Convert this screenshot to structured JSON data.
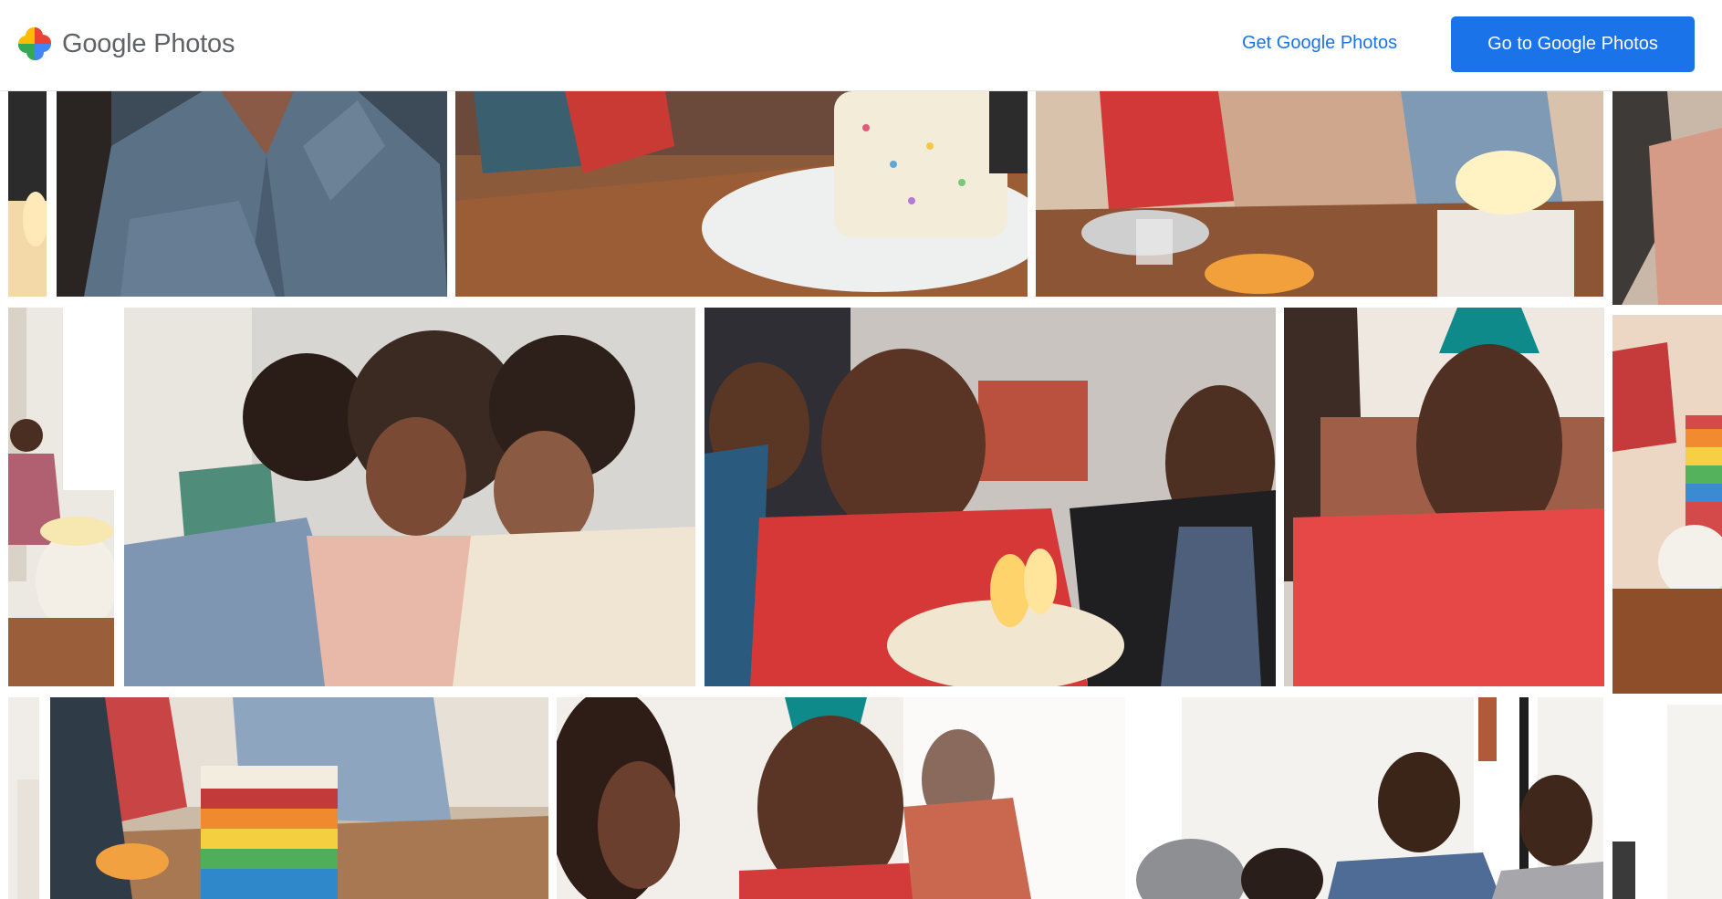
{
  "header": {
    "brand_word": "Google",
    "product_word": "Photos",
    "get_link_label": "Get Google Photos",
    "go_button_label": "Go to Google Photos"
  },
  "colors": {
    "accent": "#1a73e8",
    "logo_red": "#ea4335",
    "logo_yellow": "#fbbc04",
    "logo_green": "#34a853",
    "logo_blue": "#4285f4"
  },
  "photos": [
    {
      "row": 1,
      "subject": "edge-strip"
    },
    {
      "row": 1,
      "subject": "person-denim-shirt"
    },
    {
      "row": 1,
      "subject": "sprinkle-cake-on-table"
    },
    {
      "row": 1,
      "subject": "table-with-candles-cake"
    },
    {
      "row": 1,
      "subject": "edge-strip-right"
    },
    {
      "row": 2,
      "subject": "girl-in-kitchen"
    },
    {
      "row": 2,
      "subject": "laughing-girls"
    },
    {
      "row": 2,
      "subject": "boy-blowing-candles"
    },
    {
      "row": 2,
      "subject": "smiling-boy-party-hat"
    },
    {
      "row": 2,
      "subject": "rainbow-cake-edge"
    },
    {
      "row": 3,
      "subject": "edge-strip"
    },
    {
      "row": 3,
      "subject": "rainbow-cake-slice"
    },
    {
      "row": 3,
      "subject": "boy-party-hat-profile"
    },
    {
      "row": 3,
      "subject": "family-at-table"
    },
    {
      "row": 3,
      "subject": "edge-strip-right"
    }
  ]
}
